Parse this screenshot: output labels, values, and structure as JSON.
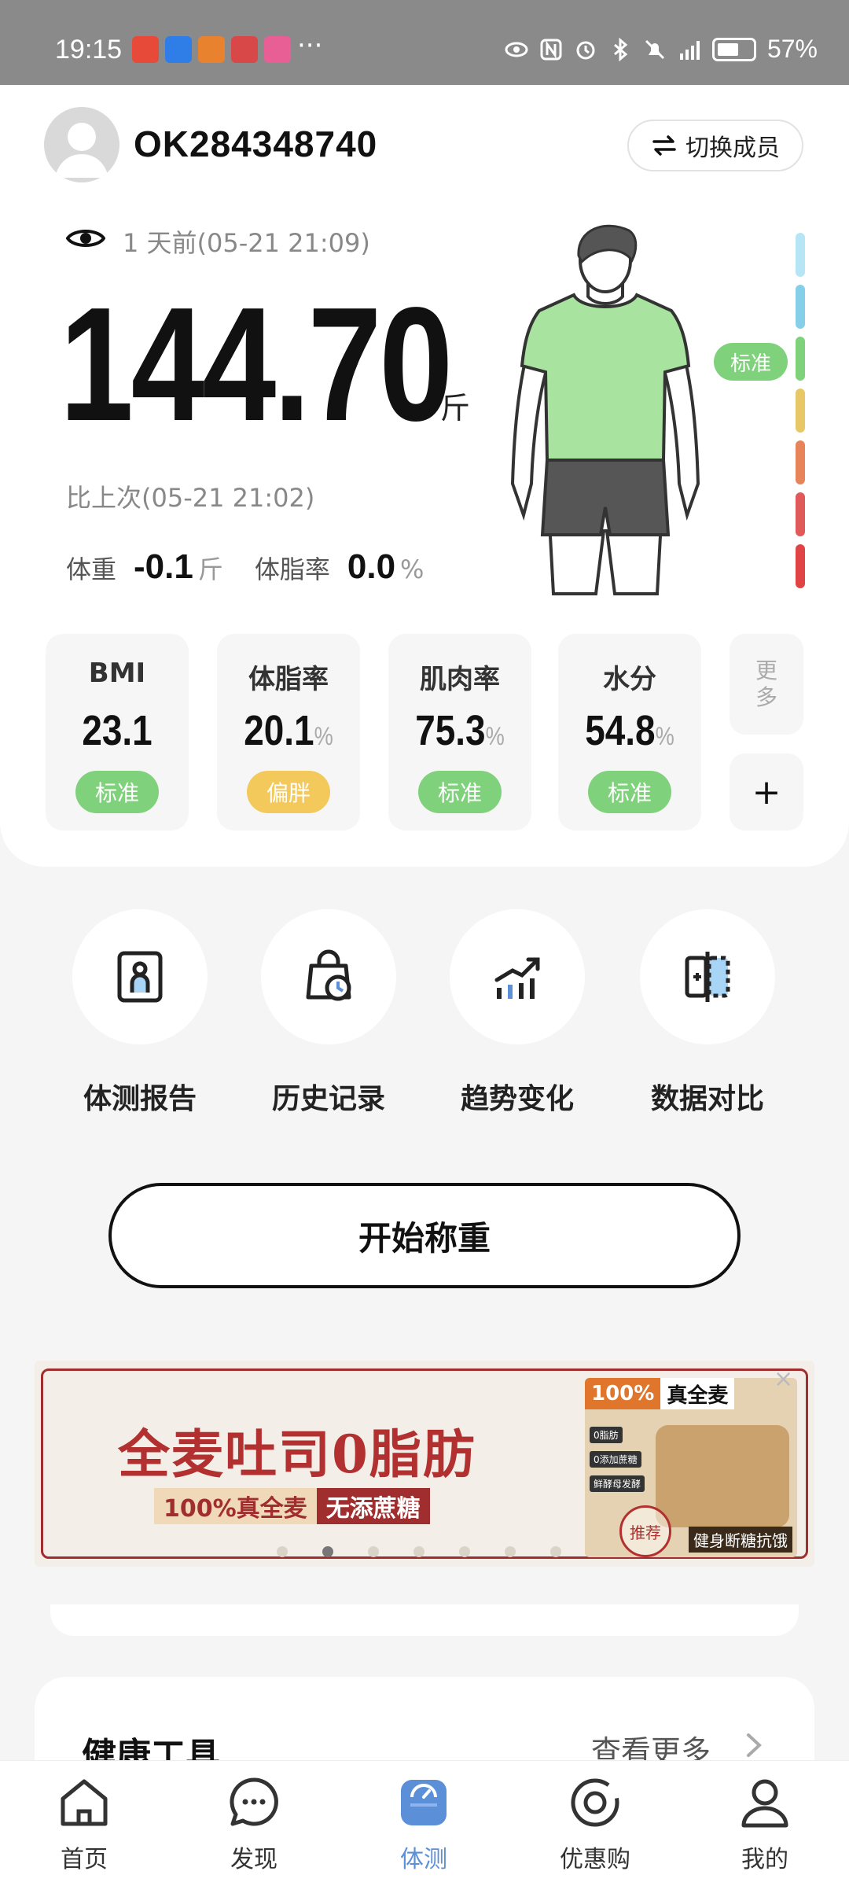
{
  "status_bar": {
    "time": "19:15",
    "dots": "···",
    "battery": "57%"
  },
  "header": {
    "username": "OK284348740",
    "switch_label": "切换成员"
  },
  "weight": {
    "last_time": "1 天前(05-21 21:09)",
    "value": "144.70",
    "unit": "斤",
    "compare_label": "比上次(05-21 21:02)",
    "diff_weight_label": "体重",
    "diff_weight": "-0.1",
    "diff_weight_unit": "斤",
    "diff_fat_label": "体脂率",
    "diff_fat": "0.0",
    "diff_fat_unit": "%",
    "status_badge": "标准"
  },
  "metrics": [
    {
      "label": "BMI",
      "value": "23.1",
      "unit": "",
      "badge": "标准",
      "badge_color": "#7fd27b"
    },
    {
      "label": "体脂率",
      "value": "20.1",
      "unit": "%",
      "badge": "偏胖",
      "badge_color": "#f2c95a"
    },
    {
      "label": "肌肉率",
      "value": "75.3",
      "unit": "%",
      "badge": "标准",
      "badge_color": "#7fd27b"
    },
    {
      "label": "水分",
      "value": "54.8",
      "unit": "%",
      "badge": "标准",
      "badge_color": "#7fd27b"
    }
  ],
  "more_label": "更多",
  "plus_label": "+",
  "quick_actions": [
    {
      "label": "体测报告",
      "icon": "report-icon"
    },
    {
      "label": "历史记录",
      "icon": "history-icon"
    },
    {
      "label": "趋势变化",
      "icon": "trend-icon"
    },
    {
      "label": "数据对比",
      "icon": "compare-icon"
    }
  ],
  "start_button": "开始称重",
  "banner": {
    "title": "全麦吐司0脂肪",
    "sub_left": "100%真全麦",
    "sub_right": "无添蔗糖",
    "tag_left": "100%",
    "tag_right": "真全麦",
    "list": [
      "0脂肪",
      "0添加蔗糖",
      "鲜酵母发酵"
    ],
    "footer": "健身断糖抗饿",
    "stamp": "推荐",
    "close": "×"
  },
  "tools": {
    "title": "健康工具",
    "more": "查看更多"
  },
  "nav": [
    {
      "label": "首页",
      "icon": "home-icon"
    },
    {
      "label": "发现",
      "icon": "discover-icon"
    },
    {
      "label": "体测",
      "icon": "scale-icon"
    },
    {
      "label": "优惠购",
      "icon": "deal-icon"
    },
    {
      "label": "我的",
      "icon": "profile-icon"
    }
  ],
  "colors": {
    "accent": "#5b8fd8",
    "standard": "#7fd27b",
    "overweight": "#f2c95a",
    "banner_red": "#b33030"
  }
}
